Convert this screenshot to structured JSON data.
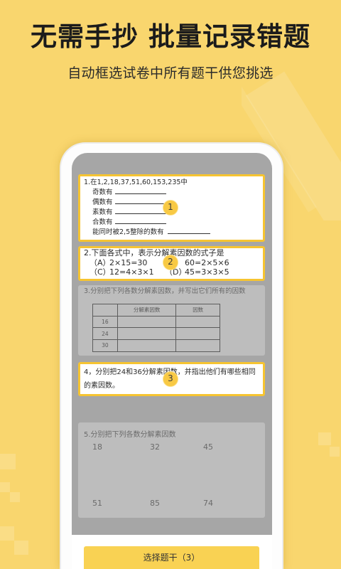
{
  "colors": {
    "background": "#F9D66E",
    "highlight_border": "#F6C431",
    "badge": "#F8C944",
    "button": "#F9D253",
    "dimmed_screen": "#A6A6A6",
    "dimmed_card": "#BDBDBD"
  },
  "header": {
    "title_left": "无需手抄",
    "title_right": "批量记录错题",
    "subtitle": "自动框选试卷中所有题干供您挑选"
  },
  "paper": {
    "q1": {
      "selected": true,
      "badge": "1",
      "stem": "1.在1,2,18,37,51,60,153,235中",
      "blanks": [
        "奇数有",
        "偶数有",
        "素数有",
        "合数有",
        "能同时被2,5整除的数有"
      ]
    },
    "q2": {
      "selected": true,
      "badge": "2",
      "stem": "2.下面各式中，表示分解素因数的式子是",
      "options": [
        {
          "label": "（A）",
          "value": "2×15=30"
        },
        {
          "label": "",
          "value": "60=2×5×6"
        },
        {
          "label": "（C）",
          "value": "12=4×3×1"
        },
        {
          "label": "（D）",
          "value": "45=3×3×5"
        }
      ]
    },
    "q3": {
      "selected": false,
      "stem": "3.分别把下列各数分解素因数，并写出它们所有的因数",
      "table_headers": [
        "",
        "分解素因数",
        "因数"
      ],
      "table_rows": [
        "16",
        "24",
        "30"
      ]
    },
    "q4": {
      "selected": true,
      "badge": "3",
      "stem_lines": [
        "4，分别把24和36分解素因数，并指出他们有哪些相同",
        "的素因数。"
      ]
    },
    "q5": {
      "selected": false,
      "stem": "5.分别把下列各数分解素因数",
      "numbers": [
        [
          "18",
          "32",
          "45"
        ],
        [
          "51",
          "85",
          "74"
        ]
      ]
    }
  },
  "action_button": {
    "label": "选择题干（3）"
  }
}
